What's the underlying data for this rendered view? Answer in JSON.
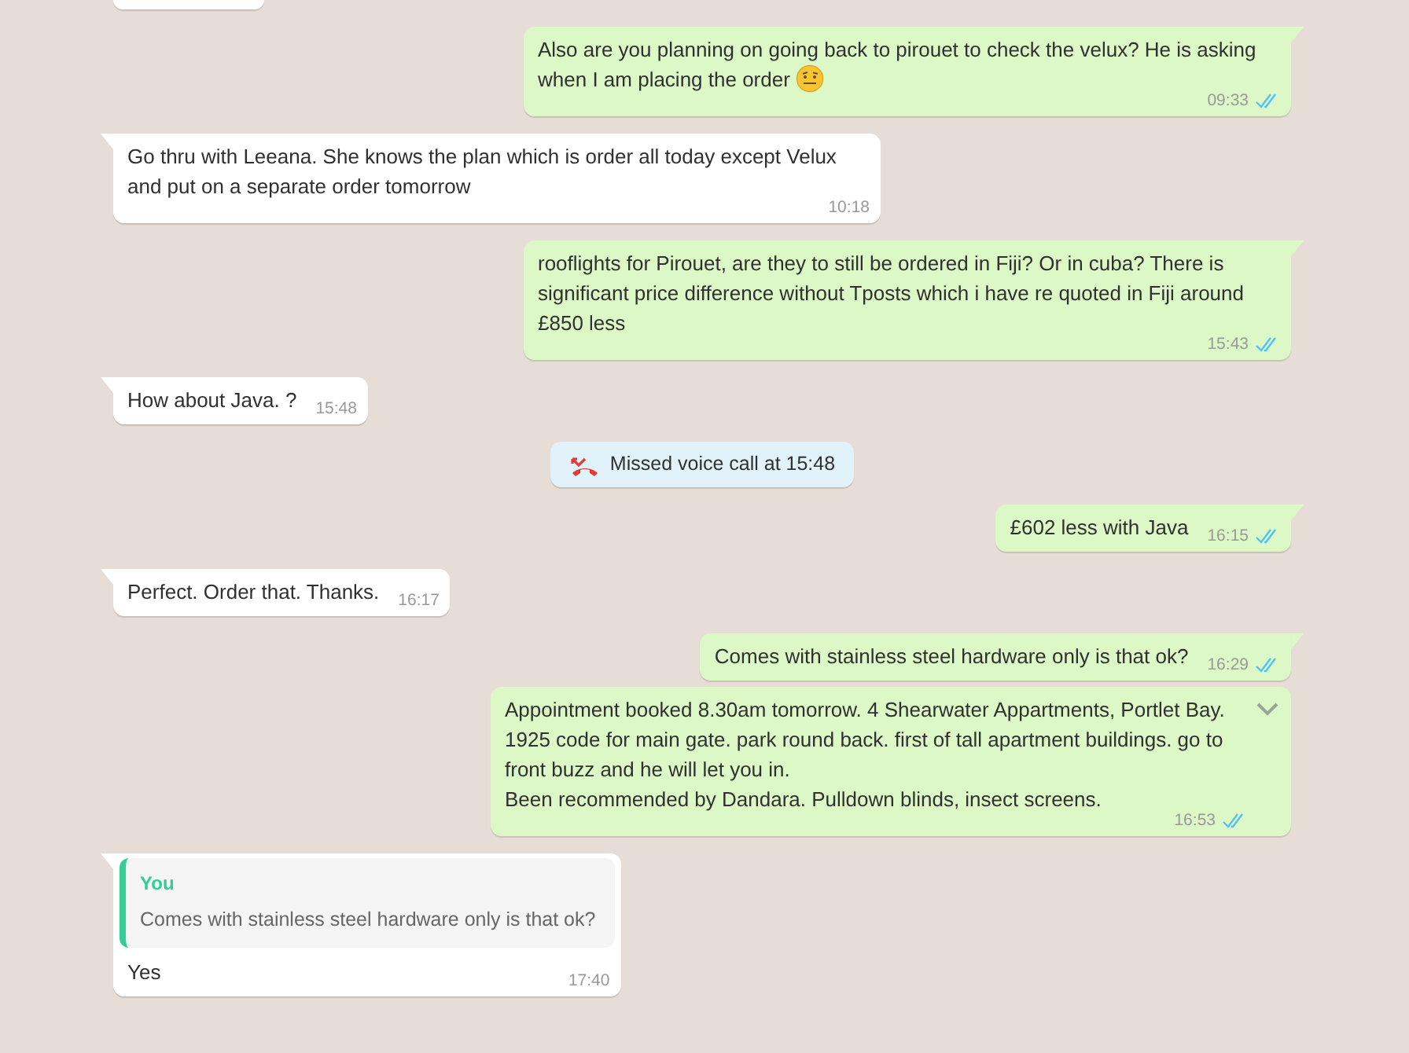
{
  "messages": [
    {
      "kind": "cut"
    },
    {
      "kind": "text",
      "outgoing": true,
      "tail": true,
      "text": "Also are you planning on going back to pirouet to check the velux? He is asking when I am placing the order",
      "emoji": true,
      "time": "09:33",
      "read": true
    },
    {
      "kind": "text",
      "outgoing": false,
      "tail": true,
      "text": "Go thru with Leeana. She knows the plan which is order all today except Velux and put on a separate order tomorrow",
      "time": "10:18"
    },
    {
      "kind": "text",
      "outgoing": true,
      "tail": true,
      "text": "rooflights for Pirouet, are they to still be ordered in Fiji? Or in cuba? There is significant price difference without Tposts which i have re quoted in Fiji around £850 less",
      "time": "15:43",
      "read": true
    },
    {
      "kind": "text",
      "outgoing": false,
      "tail": true,
      "text": "How about Java. ?",
      "time": "15:48"
    },
    {
      "kind": "call",
      "text": "Missed voice call at 15:48"
    },
    {
      "kind": "text",
      "outgoing": true,
      "tail": true,
      "text": "£602 less with Java",
      "time": "16:15",
      "read": true
    },
    {
      "kind": "text",
      "outgoing": false,
      "tail": true,
      "text": "Perfect. Order that. Thanks.",
      "time": "16:17"
    },
    {
      "kind": "text",
      "outgoing": true,
      "tail": true,
      "text": "Comes with stainless steel hardware only is that ok?",
      "time": "16:29",
      "read": true
    },
    {
      "kind": "text",
      "outgoing": true,
      "tail": false,
      "show_menu_caret": true,
      "text": "Appointment booked 8.30am tomorrow. 4 Shearwater Appartments, Portlet Bay. 1925 code for main gate. park round back. first of tall apartment buildings. go to front buzz and he will let you in.\nBeen recommended by Dandara. Pulldown blinds, insect screens.",
      "time": "16:53",
      "read": true
    },
    {
      "kind": "text",
      "outgoing": false,
      "tail": true,
      "quote": {
        "author": "You",
        "text": "Comes with stainless steel hardware only is that ok?"
      },
      "text": "Yes",
      "time": "17:40"
    }
  ]
}
